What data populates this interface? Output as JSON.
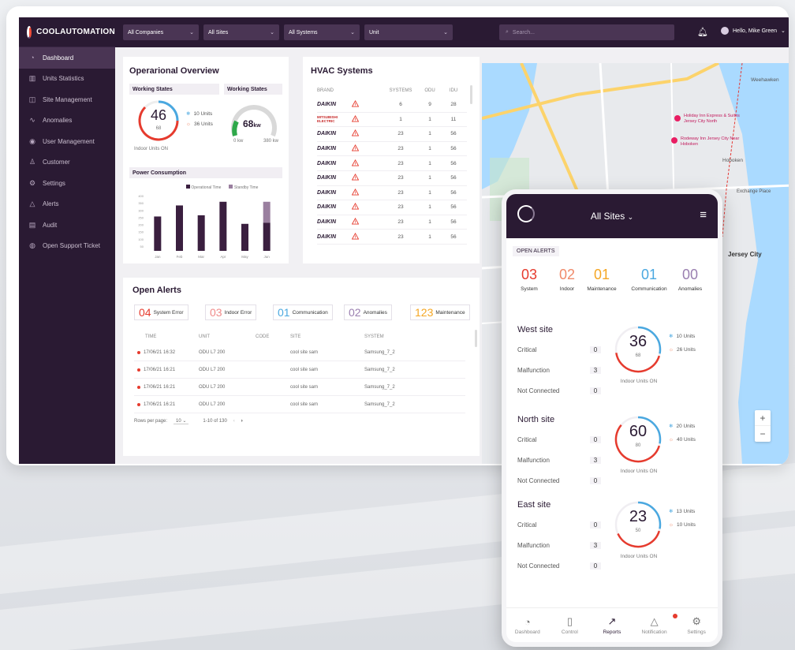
{
  "brand": {
    "name": "COOLAUTOMATION"
  },
  "sidebar": {
    "items": [
      {
        "label": "Dashboard",
        "icon": "dashboard-icon",
        "active": true
      },
      {
        "label": "Units Statistics",
        "icon": "bar-chart-icon"
      },
      {
        "label": "Site Management",
        "icon": "site-icon"
      },
      {
        "label": "Anomalies",
        "icon": "anomalies-icon"
      },
      {
        "label": "User Management",
        "icon": "user-icon"
      },
      {
        "label": "Customer",
        "icon": "customer-icon"
      },
      {
        "label": "Settings",
        "icon": "gear-icon"
      },
      {
        "label": "Alerts",
        "icon": "bell-icon"
      },
      {
        "label": "Audit",
        "icon": "audit-icon"
      },
      {
        "label": "Open Support Ticket",
        "icon": "support-icon"
      }
    ]
  },
  "topbar": {
    "filters": [
      "All Companies",
      "All Sites",
      "All Systems",
      "Unit"
    ],
    "search_placeholder": "Search...",
    "user": "Hello, Mike Green"
  },
  "overview": {
    "title": "Operarional Overview",
    "ws1": {
      "title": "Working States",
      "value": "46",
      "sub": "68",
      "cool": "10 Units",
      "heat": "36 Units",
      "caption": "Indoor Units ON"
    },
    "ws2": {
      "title": "Working States",
      "value": "68",
      "unit": "kw",
      "min": "0 kw",
      "max": "380 kw"
    },
    "power": {
      "title": "Power Consumption",
      "legend_op": "Operational Time",
      "legend_sb": "Standby Time"
    }
  },
  "chart_data": {
    "type": "bar",
    "title": "Power Consumption",
    "categories": [
      "Jan",
      "Feb",
      "Mar",
      "Apr",
      "May",
      "Jun"
    ],
    "series": [
      {
        "name": "Operational Time",
        "values": [
          280,
          370,
          290,
          400,
          220,
          230
        ]
      },
      {
        "name": "Standby Time",
        "values": [
          0,
          0,
          0,
          0,
          0,
          170
        ]
      }
    ],
    "yticks": [
      "400",
      "350",
      "300",
      "250",
      "200",
      "150",
      "100",
      "50"
    ],
    "ylim": [
      0,
      450
    ],
    "legend": "top",
    "colors": {
      "op": "#3a1f3f",
      "sb": "#9a7f9f"
    }
  },
  "hvac": {
    "title": "HVAC Systems",
    "cols": [
      "BRAND",
      "SYSTEMS",
      "ODU",
      "IDU"
    ],
    "rows": [
      {
        "brand": "DAIKIN",
        "systems": "6",
        "odu": "9",
        "idu": "28"
      },
      {
        "brand": "MITSUBISHI ELECTRIC",
        "systems": "1",
        "odu": "1",
        "idu": "11"
      },
      {
        "brand": "DAIKIN",
        "systems": "23",
        "odu": "1",
        "idu": "56"
      },
      {
        "brand": "DAIKIN",
        "systems": "23",
        "odu": "1",
        "idu": "56"
      },
      {
        "brand": "DAIKIN",
        "systems": "23",
        "odu": "1",
        "idu": "56"
      },
      {
        "brand": "DAIKIN",
        "systems": "23",
        "odu": "1",
        "idu": "56"
      },
      {
        "brand": "DAIKIN",
        "systems": "23",
        "odu": "1",
        "idu": "56"
      },
      {
        "brand": "DAIKIN",
        "systems": "23",
        "odu": "1",
        "idu": "56"
      },
      {
        "brand": "DAIKIN",
        "systems": "23",
        "odu": "1",
        "idu": "56"
      },
      {
        "brand": "DAIKIN",
        "systems": "23",
        "odu": "1",
        "idu": "56"
      }
    ]
  },
  "alerts": {
    "title": "Open Alerts",
    "chips": [
      {
        "n": "04",
        "label": "System Error",
        "color": "#e63b2e"
      },
      {
        "n": "03",
        "label": "Indoor Error",
        "color": "#f08a8a"
      },
      {
        "n": "01",
        "label": "Communication",
        "color": "#4aa8e0"
      },
      {
        "n": "02",
        "label": "Anomalies",
        "color": "#9a7fb0"
      },
      {
        "n": "123",
        "label": "Maintenance",
        "color": "#f5a623"
      }
    ],
    "cols": [
      "TIME",
      "UNIT",
      "CODE",
      "SITE",
      "SYSTEM"
    ],
    "rows": [
      {
        "time": "17/06/21  16:32",
        "unit": "ODU L7 200",
        "code": "",
        "site": "cool site sam",
        "system": "Samsung_7_2"
      },
      {
        "time": "17/06/21  16:21",
        "unit": "ODU L7 200",
        "code": "",
        "site": "cool site sam",
        "system": "Samsung_7_2"
      },
      {
        "time": "17/06/21  16:21",
        "unit": "ODU L7 200",
        "code": "",
        "site": "cool site sam",
        "system": "Samsung_7_2"
      },
      {
        "time": "17/06/21  16:21",
        "unit": "ODU L7 200",
        "code": "",
        "site": "cool site sam",
        "system": "Samsung_7_2"
      }
    ],
    "rows_per_page_label": "Rows per page:",
    "rows_per_page": "10",
    "range": "1-10 of 130"
  },
  "map": {
    "labels": [
      "Weehawken",
      "Hoboken",
      "Holiday Inn Express & Suites Jersey City North",
      "Rodeway Inn Jersey City Near Hoboken",
      "Exchange Place",
      "Jersey City"
    ],
    "zoom_in": "+",
    "zoom_out": "−"
  },
  "phone": {
    "title": "All Sites",
    "open_alerts": "OPEN ALERTS",
    "counts": [
      {
        "n": "03",
        "label": "System",
        "color": "#e63b2e"
      },
      {
        "n": "02",
        "label": "Indoor",
        "color": "#f08a6a"
      },
      {
        "n": "01",
        "label": "Maintenance",
        "color": "#f5a623"
      },
      {
        "n": "01",
        "label": "Communication",
        "color": "#4aa8e0"
      },
      {
        "n": "00",
        "label": "Anomalies",
        "color": "#9a7fb0"
      }
    ],
    "row_labels": {
      "critical": "Critical",
      "malfunction": "Malfunction",
      "not_connected": "Not Connected",
      "caption": "Indoor Units ON"
    },
    "sites": [
      {
        "name": "West site",
        "critical": "0",
        "malfunction": "3",
        "not_connected": "0",
        "value": "36",
        "sub": "68",
        "cool": "10 Units",
        "heat": "26 Units"
      },
      {
        "name": "North site",
        "critical": "0",
        "malfunction": "3",
        "not_connected": "0",
        "value": "60",
        "sub": "80",
        "cool": "20 Units",
        "heat": "40 Units"
      },
      {
        "name": "East site",
        "critical": "0",
        "malfunction": "3",
        "not_connected": "0",
        "value": "23",
        "sub": "50",
        "cool": "13 Units",
        "heat": "10 Units"
      }
    ],
    "tabs": [
      {
        "label": "Dashboard",
        "icon": "gauge-icon"
      },
      {
        "label": "Control",
        "icon": "device-icon"
      },
      {
        "label": "Reports",
        "icon": "trend-icon",
        "active": true
      },
      {
        "label": "Notification",
        "icon": "bell-icon"
      },
      {
        "label": "Settings",
        "icon": "gear-icon"
      }
    ]
  }
}
